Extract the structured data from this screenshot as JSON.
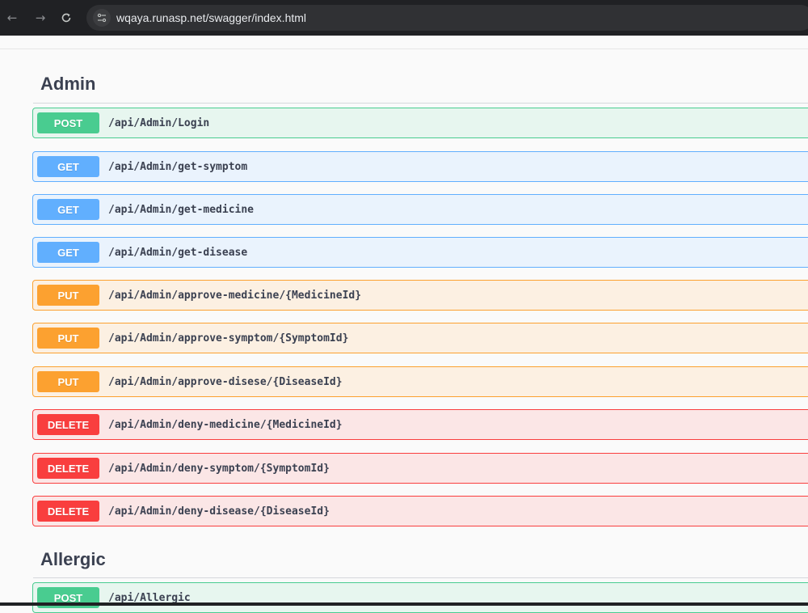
{
  "browser": {
    "url": "wqaya.runasp.net/swagger/index.html",
    "icons": [
      "back-arrow-icon",
      "forward-arrow-icon",
      "reload-icon",
      "site-info-icon"
    ]
  },
  "sections": [
    {
      "title": "Admin",
      "operations": [
        {
          "method": "POST",
          "path": "/api/Admin/Login"
        },
        {
          "method": "GET",
          "path": "/api/Admin/get-symptom"
        },
        {
          "method": "GET",
          "path": "/api/Admin/get-medicine"
        },
        {
          "method": "GET",
          "path": "/api/Admin/get-disease"
        },
        {
          "method": "PUT",
          "path": "/api/Admin/approve-medicine/{MedicineId}"
        },
        {
          "method": "PUT",
          "path": "/api/Admin/approve-symptom/{SymptomId}"
        },
        {
          "method": "PUT",
          "path": "/api/Admin/approve-disese/{DiseaseId}"
        },
        {
          "method": "DELETE",
          "path": "/api/Admin/deny-medicine/{MedicineId}"
        },
        {
          "method": "DELETE",
          "path": "/api/Admin/deny-symptom/{SymptomId}"
        },
        {
          "method": "DELETE",
          "path": "/api/Admin/deny-disease/{DiseaseId}"
        }
      ]
    },
    {
      "title": "Allergic",
      "operations": [
        {
          "method": "POST",
          "path": "/api/Allergic"
        }
      ]
    }
  ],
  "colors": {
    "post": "#49cc90",
    "get": "#61affe",
    "put": "#fca130",
    "delete": "#f93e3e",
    "text": "#3b4151"
  }
}
